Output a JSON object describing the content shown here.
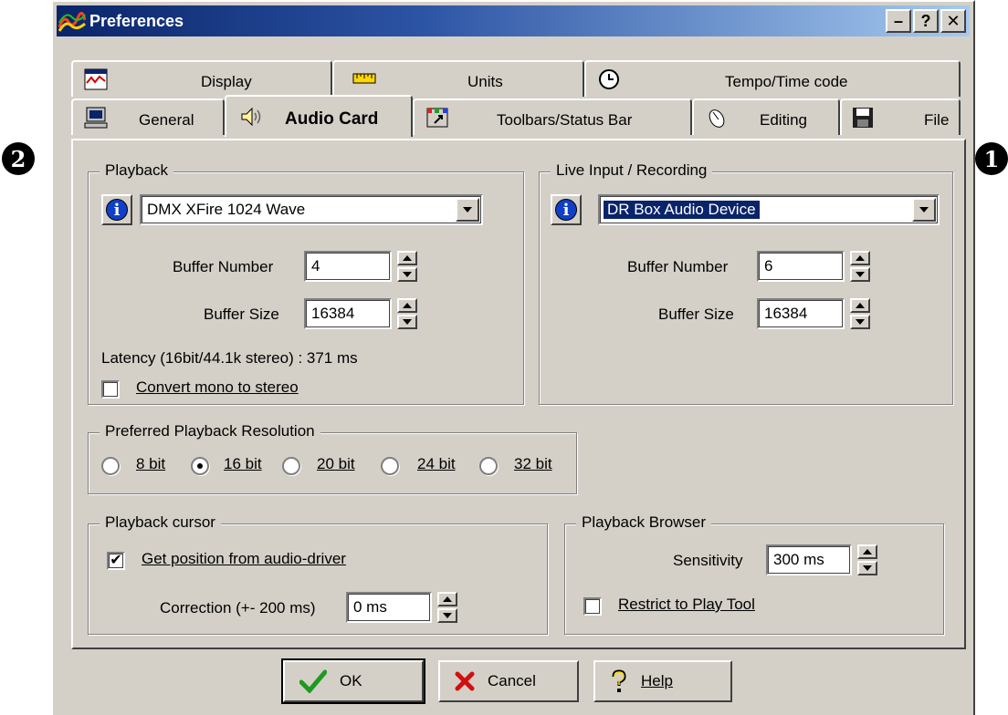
{
  "window": {
    "title": "Preferences"
  },
  "title_buttons": {
    "minimize": "–",
    "help": "?",
    "close": "✕"
  },
  "callouts": {
    "left": "2",
    "right": "1"
  },
  "tabs": {
    "row_top": [
      {
        "label": "Display",
        "icon": "display-icon"
      },
      {
        "label": "Units",
        "icon": "ruler-icon"
      },
      {
        "label": "Tempo/Time code",
        "icon": "clock-icon"
      }
    ],
    "row_bottom": [
      {
        "label": "General",
        "icon": "computer-icon"
      },
      {
        "label": "Audio Card",
        "icon": "speaker-icon",
        "active": true
      },
      {
        "label": "Toolbars/Status Bar",
        "icon": "toolbar-icon"
      },
      {
        "label": "Editing",
        "icon": "mouse-icon"
      },
      {
        "label": "File",
        "icon": "floppy-icon"
      }
    ]
  },
  "playback": {
    "legend": "Playback",
    "device": "DMX XFire 1024 Wave",
    "buffer_number_label": "Buffer Number",
    "buffer_number": "4",
    "buffer_size_label": "Buffer Size",
    "buffer_size": "16384",
    "latency": "Latency (16bit/44.1k stereo) : 371 ms",
    "convert_mono_label": "Convert mono to stereo",
    "convert_mono_checked": false
  },
  "recording": {
    "legend": "Live Input / Recording",
    "device": "DR Box Audio Device",
    "buffer_number_label": "Buffer Number",
    "buffer_number": "6",
    "buffer_size_label": "Buffer Size",
    "buffer_size": "16384"
  },
  "resolution": {
    "legend": "Preferred Playback Resolution",
    "options": [
      "8 bit",
      "16 bit",
      "20 bit",
      "24 bit",
      "32 bit"
    ],
    "selected": "16 bit"
  },
  "cursor": {
    "legend": "Playback cursor",
    "get_position_label": "Get position from audio-driver",
    "get_position_checked": true,
    "correction_label": "Correction (+- 200 ms)",
    "correction_value": "0 ms"
  },
  "browser": {
    "legend": "Playback Browser",
    "sensitivity_label": "Sensitivity",
    "sensitivity_value": "300 ms",
    "restrict_label": "Restrict to Play Tool",
    "restrict_checked": false
  },
  "buttons": {
    "ok": "OK",
    "cancel": "Cancel",
    "help": "Help"
  },
  "colors": {
    "face": "#d4d0c8",
    "title_start": "#0a246a",
    "title_end": "#a6caf0",
    "selection": "#0a246a"
  }
}
